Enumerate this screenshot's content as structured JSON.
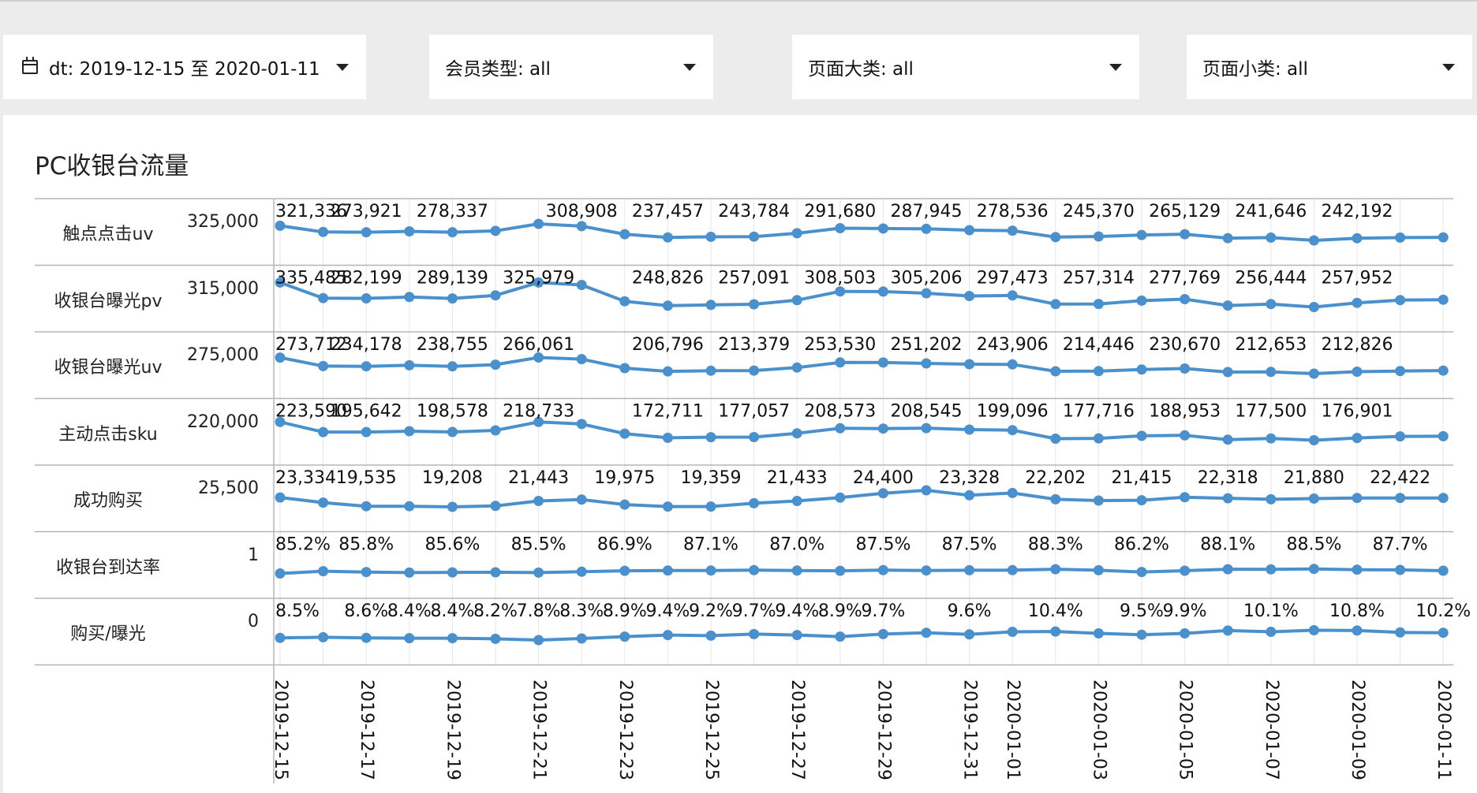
{
  "filters": {
    "date_label": "dt: 2019-12-15 至 2020-01-11",
    "member_label": "会员类型: all",
    "category_label": "页面大类: all",
    "subcategory_label": "页面小类: all"
  },
  "colors": {
    "line": "#4a90cc",
    "grid": "#e6e6e6",
    "rule": "#b5b5b5"
  },
  "chart_data": {
    "type": "line",
    "title": "PC收银台流量",
    "dates": [
      "2019-12-15",
      "2019-12-16",
      "2019-12-17",
      "2019-12-18",
      "2019-12-19",
      "2019-12-20",
      "2019-12-21",
      "2019-12-22",
      "2019-12-23",
      "2019-12-24",
      "2019-12-25",
      "2019-12-26",
      "2019-12-27",
      "2019-12-28",
      "2019-12-29",
      "2019-12-30",
      "2019-12-31",
      "2020-01-01",
      "2020-01-02",
      "2020-01-03",
      "2020-01-04",
      "2020-01-05",
      "2020-01-06",
      "2020-01-07",
      "2020-01-08",
      "2020-01-09",
      "2020-01-10",
      "2020-01-11"
    ],
    "x_tick_labels": [
      "2019-12-15",
      "2019-12-17",
      "2019-12-19",
      "2019-12-21",
      "2019-12-23",
      "2019-12-25",
      "2019-12-27",
      "2019-12-29",
      "2019-12-31",
      "2020-01-01",
      "2020-01-03",
      "2020-01-05",
      "2020-01-07",
      "2020-01-09",
      "2020-01-11"
    ],
    "series": [
      {
        "name": "触点点击uv",
        "tick": "325,000",
        "ymax": 325000,
        "values": [
          321336,
          309000,
          308500,
          310200,
          308400,
          311200,
          325000,
          320500,
          304600,
          298200,
          299500,
          299800,
          306400,
          316500,
          315800,
          315200,
          312500,
          311600,
          298800,
          300000,
          303000,
          304600,
          296800,
          297900,
          292200,
          296600,
          297900,
          298300
        ],
        "labels": [
          "321,336",
          "",
          "273,921",
          "",
          "278,337",
          "",
          "",
          "308,908",
          "",
          "237,457",
          "",
          "243,784",
          "",
          "291,680",
          "",
          "287,945",
          "",
          "278,536",
          "",
          "245,370",
          "",
          "265,129",
          "",
          "241,646",
          "",
          "242,192",
          "",
          ""
        ]
      },
      {
        "name": "收银台曝光pv",
        "tick": "315,000",
        "ymax": 315000,
        "values": [
          335485,
          295500,
          294800,
          298200,
          294600,
          302400,
          335400,
          329200,
          287300,
          276100,
          278100,
          279600,
          290200,
          312500,
          312100,
          308000,
          300800,
          302200,
          280000,
          280400,
          289000,
          292700,
          276400,
          280200,
          272500,
          283300,
          290300,
          291400
        ],
        "labels": [
          "335,485",
          "",
          "282,199",
          "",
          "289,139",
          "",
          "325,979",
          "",
          "",
          "248,826",
          "",
          "257,091",
          "",
          "308,503",
          "",
          "305,206",
          "",
          "297,473",
          "",
          "257,314",
          "",
          "277,769",
          "",
          "256,444",
          "",
          "257,952",
          "",
          ""
        ]
      },
      {
        "name": "收银台曝光uv",
        "tick": "275,000",
        "ymax": 275000,
        "values": [
          273712,
          248500,
          247800,
          250700,
          247500,
          252500,
          273800,
          268900,
          242300,
          232800,
          234600,
          235000,
          243900,
          259100,
          258800,
          256300,
          253900,
          253400,
          233100,
          233500,
          238100,
          241100,
          230600,
          231200,
          225900,
          231800,
          233700,
          235000
        ],
        "labels": [
          "273,712",
          "",
          "234,178",
          "",
          "238,755",
          "",
          "266,061",
          "",
          "",
          "206,796",
          "",
          "213,379",
          "",
          "253,530",
          "",
          "251,202",
          "",
          "243,906",
          "",
          "214,446",
          "",
          "230,670",
          "",
          "212,653",
          "",
          "212,826",
          "",
          ""
        ]
      },
      {
        "name": "主动点击sku",
        "tick": "220,000",
        "ymax": 220000,
        "values": [
          223590,
          202500,
          202500,
          204300,
          202700,
          206000,
          223600,
          219400,
          199200,
          190500,
          191800,
          192000,
          199900,
          210400,
          209800,
          210700,
          207700,
          206500,
          188700,
          189300,
          194600,
          195600,
          186700,
          189100,
          185300,
          190100,
          193500,
          193700
        ],
        "labels": [
          "223,590",
          "",
          "195,642",
          "",
          "198,578",
          "",
          "218,733",
          "",
          "",
          "172,711",
          "",
          "177,057",
          "",
          "208,573",
          "",
          "208,545",
          "",
          "199,096",
          "",
          "177,716",
          "",
          "188,953",
          "",
          "177,500",
          "",
          "176,901",
          "",
          ""
        ]
      },
      {
        "name": "成功购买",
        "tick": "25,500",
        "ymax": 25500,
        "values": [
          23334,
          21800,
          20700,
          20700,
          20500,
          20800,
          22300,
          22700,
          21200,
          20600,
          20600,
          21600,
          22300,
          23300,
          24600,
          25500,
          24000,
          24700,
          22800,
          22400,
          22500,
          23400,
          23100,
          22800,
          23000,
          23200,
          23200,
          23200
        ],
        "labels": [
          "23,334",
          "",
          "19,535",
          "",
          "19,208",
          "",
          "21,443",
          "",
          "19,975",
          "",
          "19,359",
          "",
          "21,433",
          "",
          "24,400",
          "",
          "23,328",
          "",
          "22,202",
          "",
          "21,415",
          "",
          "22,318",
          "",
          "21,880",
          "",
          "22,422",
          ""
        ]
      },
      {
        "name": "收银台到达率",
        "tick": "1",
        "ymax": 1,
        "values": [
          0.852,
          0.873,
          0.865,
          0.86,
          0.862,
          0.863,
          0.86,
          0.868,
          0.876,
          0.878,
          0.878,
          0.882,
          0.878,
          0.876,
          0.882,
          0.879,
          0.881,
          0.882,
          0.89,
          0.881,
          0.866,
          0.877,
          0.89,
          0.889,
          0.893,
          0.886,
          0.884,
          0.877
        ],
        "labels": [
          "85.2%",
          "",
          "85.8%",
          "",
          "85.6%",
          "",
          "85.5%",
          "",
          "86.9%",
          "",
          "87.1%",
          "",
          "87.0%",
          "",
          "87.5%",
          "",
          "87.5%",
          "",
          "88.3%",
          "",
          "86.2%",
          "",
          "88.1%",
          "",
          "88.5%",
          "",
          "87.7%",
          ""
        ]
      },
      {
        "name": "购买/曝光",
        "tick": "0",
        "ymax": 0.13,
        "values": [
          0.085,
          0.087,
          0.085,
          0.084,
          0.084,
          0.082,
          0.078,
          0.083,
          0.089,
          0.094,
          0.092,
          0.097,
          0.094,
          0.089,
          0.097,
          0.101,
          0.096,
          0.104,
          0.105,
          0.099,
          0.095,
          0.099,
          0.108,
          0.104,
          0.109,
          0.108,
          0.102,
          0.101
        ],
        "labels": [
          "8.5%",
          "",
          "8.6%",
          "8.4%",
          "8.4%",
          "8.2%",
          "7.8%",
          "8.3%",
          "8.9%",
          "9.4%",
          "9.2%",
          "9.7%",
          "9.4%",
          "8.9%",
          "9.7%",
          "",
          "9.6%",
          "",
          "10.4%",
          "",
          "9.5%",
          "9.9%",
          "",
          "10.1%",
          "",
          "10.8%",
          "",
          "10.2%"
        ]
      }
    ]
  }
}
